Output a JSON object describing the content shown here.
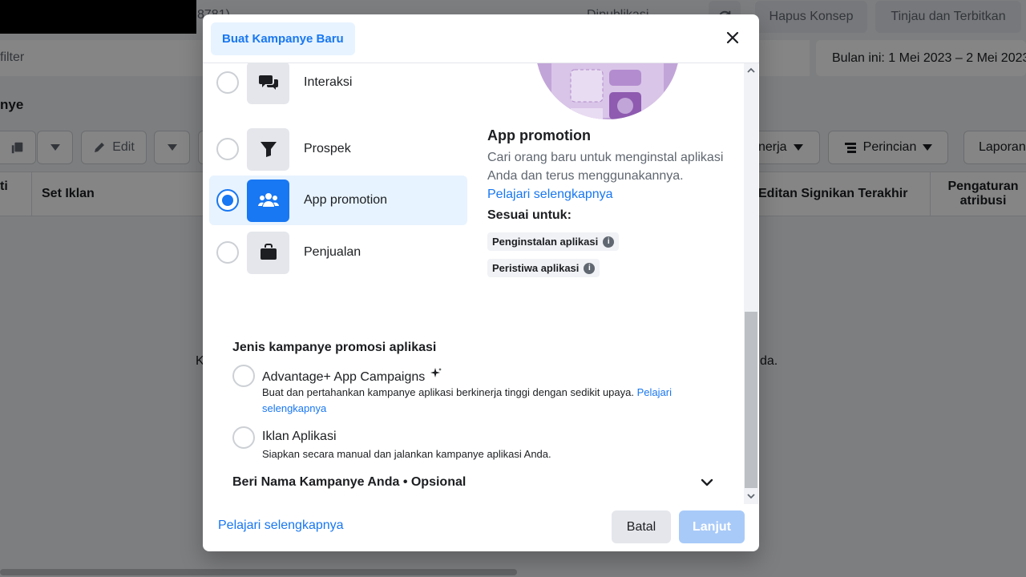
{
  "background": {
    "top_partial_text": "8781)",
    "top_partial_text2": "Dipublikasi",
    "buttons": {
      "discard_draft": "Hapus Konsep",
      "review_publish": "Tinjau dan Terbitkan"
    },
    "search_placeholder": "filter",
    "date_range": "Bulan ini: 1 Mei 2023 – 2 Mei 2023",
    "section_title": "nye",
    "toolbar": {
      "edit": "Edit",
      "performance": "nerja",
      "breakdown": "Perincian",
      "reports": "Laporan"
    },
    "table_headers": {
      "col0": "ti",
      "ad_set": "Set Iklan",
      "last_significant_edit": "Editan Signikan Terakhir",
      "attribution_setting": "Pengaturan atribusi"
    },
    "empty_left": "K",
    "empty_right": "da."
  },
  "modal": {
    "title": "Buat Kampanye Baru",
    "objectives": [
      {
        "label": "Interaksi",
        "icon": "chat-bubbles-icon",
        "selected": false
      },
      {
        "label": "Prospek",
        "icon": "funnel-icon",
        "selected": false
      },
      {
        "label": "App promotion",
        "icon": "people-icon",
        "selected": true
      },
      {
        "label": "Penjualan",
        "icon": "shopping-bag-icon",
        "selected": false
      }
    ],
    "detail": {
      "title": "App promotion",
      "description": "Cari orang baru untuk menginstal aplikasi Anda dan terus menggunakannya.",
      "learn_more": "Pelajari selengkapnya",
      "good_for_label": "Sesuai untuk:",
      "chips": [
        "Penginstalan aplikasi",
        "Peristiwa aplikasi"
      ]
    },
    "campaign_type": {
      "title": "Jenis kampanye promosi aplikasi",
      "options": [
        {
          "name": "Advantage+ App Campaigns",
          "description": "Buat dan pertahankan kampanye aplikasi berkinerja tinggi dengan sedikit upaya.",
          "link": "Pelajari selengkapnya"
        },
        {
          "name": "Iklan Aplikasi",
          "description": "Siapkan secara manual dan jalankan kampanye aplikasi Anda."
        }
      ]
    },
    "name_campaign": "Beri Nama Kampanye Anda • Opsional",
    "footer": {
      "learn_more": "Pelajari selengkapnya",
      "cancel": "Batal",
      "next": "Lanjut"
    },
    "colors": {
      "primary": "#1877f2",
      "selected_bg": "#e7f3ff",
      "disabled_button": "#a8caf8",
      "illustration": "#c2a5d8"
    }
  }
}
